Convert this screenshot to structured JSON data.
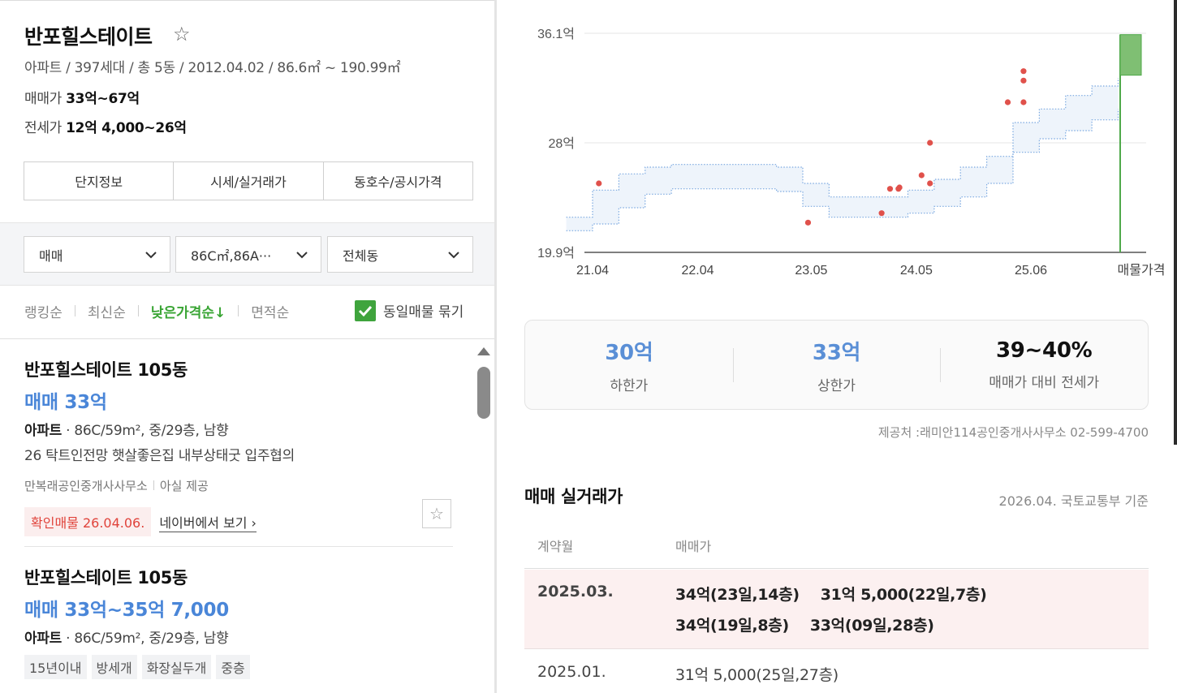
{
  "complex": {
    "name": "반포힐스테이트",
    "meta": "아파트 / 397세대 / 총 5동 / 2012.04.02 / 86.6㎡ ~ 190.99㎡",
    "sale_label": "매매가",
    "sale_value": "33억~67억",
    "jeonse_label": "전세가",
    "jeonse_value": "12억 4,000~26억"
  },
  "tabs": [
    "단지정보",
    "시세/실거래가",
    "동호수/공시가격"
  ],
  "filters": {
    "trade": "매매",
    "area": "86C㎡,86A···",
    "dong": "전체동"
  },
  "sort": {
    "options": [
      "랭킹순",
      "최신순",
      "낮은가격순↓",
      "면적순"
    ],
    "active": "낮은가격순↓",
    "group_same_label": "동일매물 묶기",
    "group_same_checked": true
  },
  "listings": [
    {
      "name": "반포힐스테이트 105동",
      "deal": "매매 33억",
      "spec_type": "아파트",
      "spec": "86C/59m², 중/29층, 남향",
      "desc": "26 탁트인전망 햇살좋은집 내부상태굿 입주협의",
      "agent": "만복래공인중개사사무소",
      "source": "아실 제공",
      "confirm": "확인매물 26.04.06.",
      "link": "네이버에서 보기 ›"
    },
    {
      "name": "반포힐스테이트 105동",
      "deal": "매매 33억~35억 7,000",
      "spec_type": "아파트",
      "spec": "86C/59m², 중/29층, 남향",
      "tags": [
        "15년이내",
        "방세개",
        "화장실두개",
        "중층"
      ]
    }
  ],
  "chart_data": {
    "type": "scatter",
    "y_ticks": [
      "36.1억",
      "28억",
      "19.9억"
    ],
    "y_tick_values": [
      36.1,
      28,
      19.9
    ],
    "ylim": [
      19.9,
      36.1
    ],
    "x_ticks": [
      "21.04",
      "22.04",
      "23.05",
      "24.05",
      "25.06",
      "매물가격"
    ],
    "x_tick_values": [
      2021.25,
      2022.25,
      2023.33,
      2024.33,
      2025.42
    ],
    "transactions": [
      {
        "x": 2021.31,
        "y": 25.0
      },
      {
        "x": 2023.3,
        "y": 22.1
      },
      {
        "x": 2024.0,
        "y": 22.8
      },
      {
        "x": 2024.08,
        "y": 24.6
      },
      {
        "x": 2024.16,
        "y": 24.6
      },
      {
        "x": 2024.17,
        "y": 24.7
      },
      {
        "x": 2024.38,
        "y": 25.6
      },
      {
        "x": 2024.46,
        "y": 25.0
      },
      {
        "x": 2024.46,
        "y": 28.0
      },
      {
        "x": 2025.2,
        "y": 31.0
      },
      {
        "x": 2025.35,
        "y": 31.0
      },
      {
        "x": 2025.35,
        "y": 32.6
      },
      {
        "x": 2025.35,
        "y": 33.3
      }
    ],
    "band": {
      "x": [
        2021.0,
        2021.25,
        2021.5,
        2021.75,
        2022.0,
        2022.25,
        2022.5,
        2022.75,
        2023.0,
        2023.25,
        2023.5,
        2023.75,
        2024.0,
        2024.25,
        2024.5,
        2024.75,
        2025.0,
        2025.25,
        2025.5,
        2025.75,
        2026.0,
        2026.25
      ],
      "upper": [
        22.5,
        24.5,
        25.7,
        26.2,
        26.4,
        26.4,
        26.4,
        26.4,
        26.2,
        25.0,
        24.0,
        24.0,
        24.0,
        24.5,
        25.3,
        26.2,
        27.0,
        29.5,
        30.5,
        31.5,
        32.2,
        32.8
      ],
      "lower": [
        21.5,
        22.0,
        23.2,
        24.2,
        24.6,
        24.6,
        24.6,
        24.6,
        24.4,
        23.3,
        22.5,
        22.5,
        22.5,
        22.8,
        23.3,
        24.0,
        25.0,
        27.3,
        28.3,
        28.9,
        29.7,
        30.5
      ]
    },
    "listing_price_range": [
      33,
      36
    ],
    "colors": {
      "dot": "#e0514b",
      "band_fill": "#eef4fb",
      "band_line": "#7aa8e0",
      "listing_bar": "#7fbf73",
      "listing_line": "#4fa94a",
      "grid": "#e6e6e6"
    }
  },
  "summary": {
    "low_value": "30억",
    "low_label": "하한가",
    "high_value": "33억",
    "high_label": "상한가",
    "ratio_value": "39~40%",
    "ratio_label": "매매가 대비 전세가"
  },
  "provider": "제공처 :래미안114공인중개사사무소 02-599-4700",
  "transactions_section": {
    "title": "매매 실거래가",
    "basis": "2026.04. 국토교통부 기준",
    "col_month": "계약월",
    "col_price": "매매가",
    "rows": [
      {
        "month": "2025.03.",
        "line1": [
          "34억(23일,14층)",
          "31억 5,000(22일,7층)"
        ],
        "line2": [
          "34억(19일,8층)",
          "33억(09일,28층)"
        ]
      },
      {
        "month": "2025.01.",
        "line1": [
          "31억 5,000(25일,27층)"
        ]
      }
    ]
  }
}
